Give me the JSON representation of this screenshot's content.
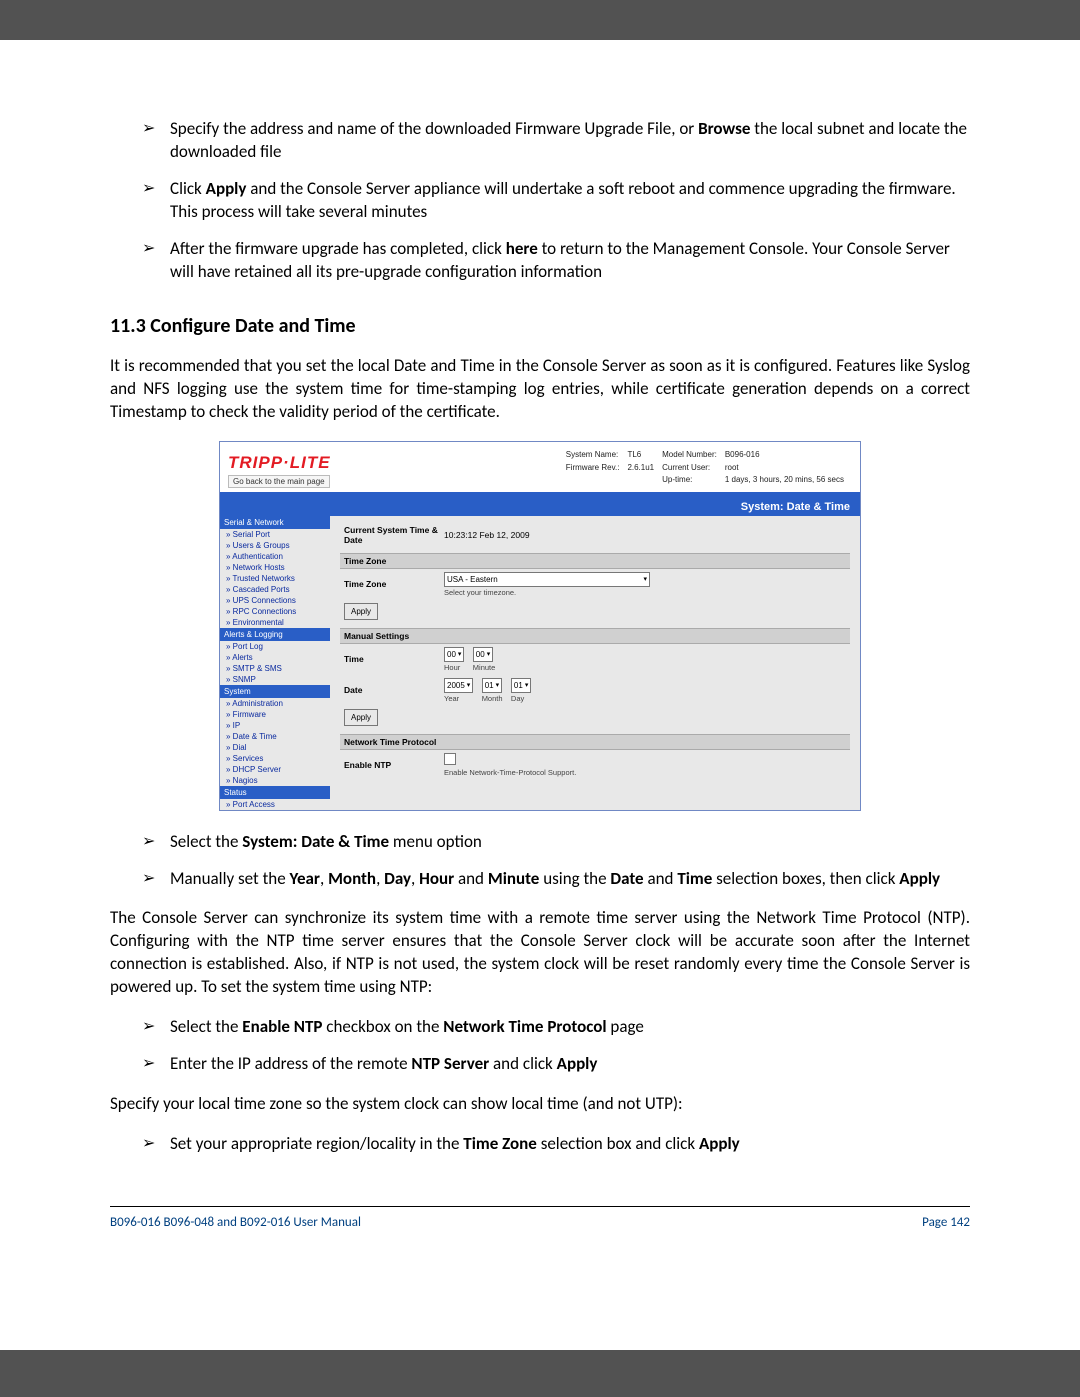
{
  "doc": {
    "bullets_top": {
      "b1_a": "Specify the address and name of the downloaded Firmware Upgrade File, or ",
      "b1_b_bold": "Browse",
      "b1_c": " the local subnet and locate the downloaded file",
      "b2_a": "Click ",
      "b2_b_bold": "Apply",
      "b2_c": " and the Console Server appliance will undertake a soft reboot and commence upgrading the firmware. This process will take several minutes",
      "b3_a": "After the firmware upgrade has completed, click ",
      "b3_b_bold": "here",
      "b3_c": " to return to the Management Console. Your Console Server will have retained all its pre-upgrade configuration information"
    },
    "section_title": "11.3   Configure Date and Time",
    "intro": "It is recommended that you set the local Date and Time in the Console Server as soon as it is configured. Features like Syslog and NFS logging use the system time for time-stamping log entries, while certificate generation depends on a correct Timestamp to check the validity period of the certificate.",
    "bullets_mid": {
      "b1_a": "Select the ",
      "b1_b_bold": "System: Date & Time",
      "b1_c": " menu option",
      "b2_a": "Manually set the ",
      "b2_b_bold": "Year",
      "b2_c": ", ",
      "b2_d_bold": "Month",
      "b2_e": ", ",
      "b2_f_bold": "Day",
      "b2_g": ", ",
      "b2_h_bold": "Hour",
      "b2_i": " and ",
      "b2_j_bold": "Minute",
      "b2_k": " using the ",
      "b2_l_bold": "Date",
      "b2_m": " and ",
      "b2_n_bold": "Time",
      "b2_o": " selection boxes, then click ",
      "b2_p_bold": "Apply"
    },
    "para2": "The Console Server can synchronize its system time with a remote time server using the Network Time Protocol (NTP). Configuring with the NTP time server ensures that the Console Server clock will be accurate soon after the Internet connection is established. Also, if NTP is not used, the system clock will be reset randomly every time the Console Server is powered up. To set the system time using NTP:",
    "bullets_ntp": {
      "b1_a": "Select the ",
      "b1_b_bold": "Enable NTP",
      "b1_c": " checkbox on the ",
      "b1_d_bold": "Network Time Protocol",
      "b1_e": " page",
      "b2_a": "Enter the IP address of the remote ",
      "b2_b_bold": "NTP Server",
      "b2_c": " and click ",
      "b2_d_bold": "Apply"
    },
    "para3": "Specify your local time zone so the system clock can show local time (and not UTP):",
    "bullets_tz": {
      "b1_a": "Set your appropriate region/locality in the ",
      "b1_b_bold": "Time Zone",
      "b1_c": " selection box and click ",
      "b1_d_bold": "Apply"
    },
    "footer_left": "B096-016 B096-048 and B092-016 User Manual",
    "footer_right": "Page 142"
  },
  "console": {
    "logo": "TRIPP·LITE",
    "back_link": "Go back to the main page",
    "hdr": {
      "sys_name_k": "System Name:",
      "sys_name_v": "TL6",
      "fw_k": "Firmware Rev.:",
      "fw_v": "2.6.1u1",
      "model_k": "Model Number:",
      "model_v": "B096-016",
      "user_k": "Current User:",
      "user_v": "root",
      "uptime_k": "Up-time:",
      "uptime_v": "1 days, 3 hours, 20 mins, 56 secs"
    },
    "titlebar": "System: Date & Time",
    "sidebar": {
      "cat1": "Serial & Network",
      "c1": [
        "Serial Port",
        "Users & Groups",
        "Authentication",
        "Network Hosts",
        "Trusted Networks",
        "Cascaded Ports",
        "UPS Connections",
        "RPC Connections",
        "Environmental"
      ],
      "cat2": "Alerts & Logging",
      "c2": [
        "Port Log",
        "Alerts",
        "SMTP & SMS",
        "SNMP"
      ],
      "cat3": "System",
      "c3": [
        "Administration",
        "Firmware",
        "IP",
        "Date & Time",
        "Dial",
        "Services",
        "DHCP Server",
        "Nagios"
      ],
      "cat4": "Status",
      "c4": [
        "Port Access"
      ]
    },
    "main": {
      "cur_time_lbl": "Current System Time & Date",
      "cur_time_val": "10:23:12 Feb 12, 2009",
      "sec_tz": "Time Zone",
      "tz_lbl": "Time Zone",
      "tz_val": "USA - Eastern",
      "tz_hint": "Select your timezone.",
      "apply": "Apply",
      "sec_manual": "Manual Settings",
      "time_lbl": "Time",
      "hour": "00",
      "hour_lbl": "Hour",
      "minute": "00",
      "minute_lbl": "Minute",
      "date_lbl": "Date",
      "year": "2005",
      "year_lbl": "Year",
      "month": "01",
      "month_lbl": "Month",
      "day": "01",
      "day_lbl": "Day",
      "sec_ntp": "Network Time Protocol",
      "ntp_enable_lbl": "Enable NTP",
      "ntp_hint": "Enable Network-Time-Protocol Support."
    }
  }
}
